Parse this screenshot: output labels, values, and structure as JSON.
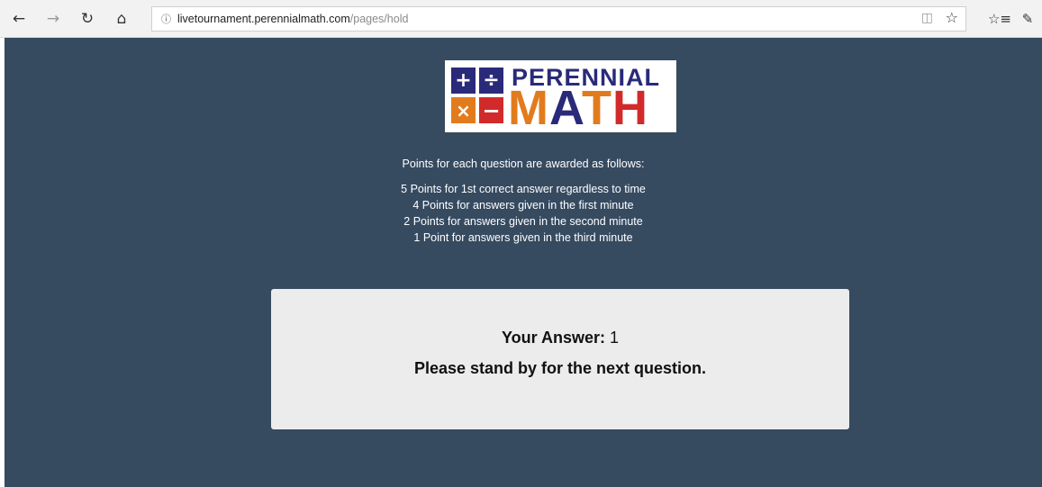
{
  "browser": {
    "back_icon": "back-arrow-icon",
    "forward_icon": "forward-arrow-icon",
    "refresh_icon": "refresh-icon",
    "home_icon": "home-icon",
    "url_host": "livetournament.perennialmath.com",
    "url_path": "/pages/hold",
    "reading_view_icon": "reading-view-icon",
    "favorite_icon": "star-icon",
    "favorites_icon": "favorites-list-icon",
    "notes_icon": "pen-icon"
  },
  "logo": {
    "word_top": "PERENNIAL",
    "word_bottom_1": "M",
    "word_bottom_2": "A",
    "word_bottom_3": "T",
    "word_bottom_4": "H",
    "tile_plus": "+",
    "tile_divide": "÷",
    "tile_times": "×",
    "tile_minus": "−",
    "colors": {
      "navy": "#2a2a7a",
      "orange": "#e27b1e",
      "red": "#d22a2a"
    }
  },
  "rules": {
    "title": "Points for each question are awarded as follows:",
    "items": [
      "5 Points for 1st correct answer regardless to time",
      "4 Points for answers given in the first minute",
      "2 Points for answers given in the second minute",
      "1 Point for answers given in the third minute"
    ]
  },
  "answer": {
    "label": "Your Answer:",
    "value": "1",
    "message": "Please stand by for the next question."
  },
  "colors": {
    "page_background": "#364a60",
    "card_background": "#ececec"
  }
}
